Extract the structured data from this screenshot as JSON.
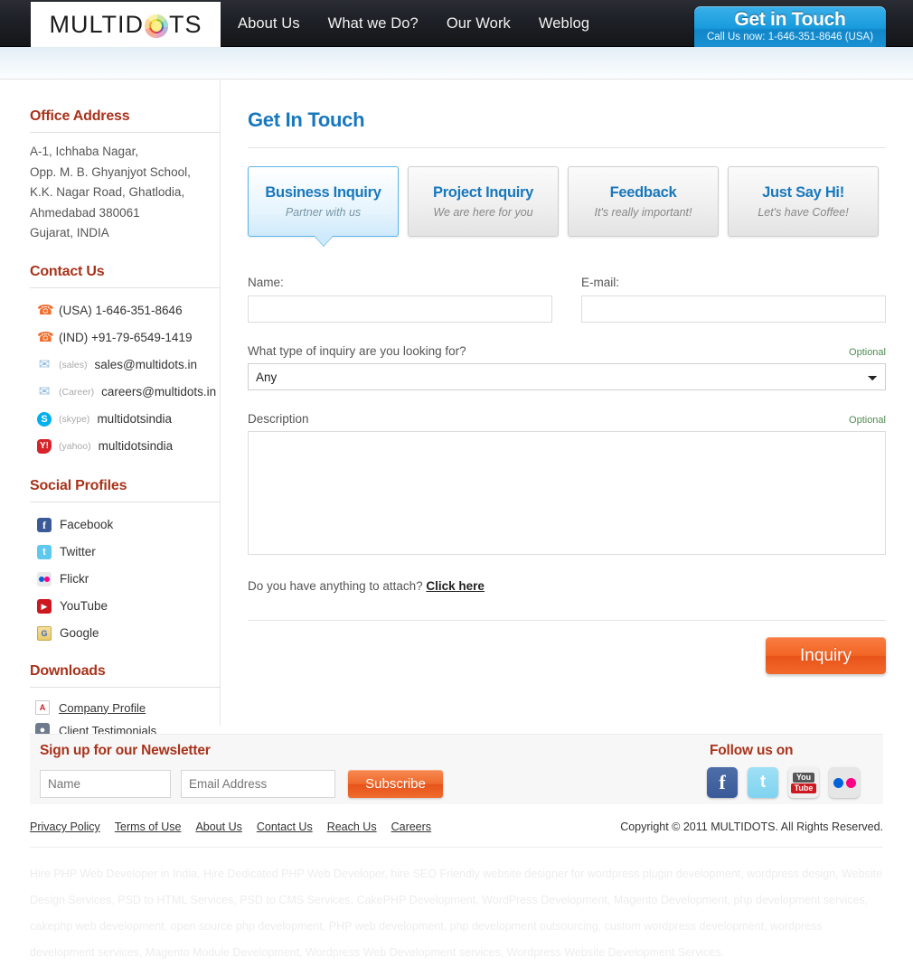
{
  "nav": {
    "logo": {
      "prefix": "MULTID",
      "dot_icon": "multidots-dot-logo",
      "suffix": "TS"
    },
    "links": [
      {
        "label": "About Us"
      },
      {
        "label": "What we Do?"
      },
      {
        "label": "Our Work"
      },
      {
        "label": "Weblog"
      }
    ],
    "cta": {
      "title": "Get in Touch",
      "subtitle": "Call Us now: 1-646-351-8646 (USA)",
      "color": "#1187c9"
    }
  },
  "sidebar": {
    "office": {
      "heading": "Office Address",
      "lines": [
        "A-1, Ichhaba Nagar,",
        "Opp. M. B. Ghyanjyot School,",
        "K.K. Nagar Road, Ghatlodia,",
        "Ahmedabad 380061",
        "Gujarat, INDIA"
      ]
    },
    "contact": {
      "heading": "Contact Us",
      "items": [
        {
          "icon": "phone-icon",
          "tag": "",
          "value": "(USA) 1-646-351-8646"
        },
        {
          "icon": "phone-icon",
          "tag": "",
          "value": "(IND) +91-79-6549-1419"
        },
        {
          "icon": "mail-icon",
          "tag": "(sales)",
          "value": "sales@multidots.in"
        },
        {
          "icon": "mail-icon",
          "tag": "(Career)",
          "value": "careers@multidots.in"
        },
        {
          "icon": "skype-icon",
          "tag": "(skype)",
          "value": "multidotsindia"
        },
        {
          "icon": "yahoo-icon",
          "tag": "(yahoo)",
          "value": "multidotsindia"
        }
      ]
    },
    "social": {
      "heading": "Social Profiles",
      "items": [
        {
          "icon": "facebook-icon",
          "label": "Facebook"
        },
        {
          "icon": "twitter-icon",
          "label": "Twitter"
        },
        {
          "icon": "flickr-icon",
          "label": "Flickr"
        },
        {
          "icon": "youtube-icon",
          "label": "YouTube"
        },
        {
          "icon": "google-icon",
          "label": "Google"
        }
      ]
    },
    "downloads": {
      "heading": "Downloads",
      "items": [
        {
          "icon": "pdf-icon",
          "label": "Company Profile"
        },
        {
          "icon": "person-icon",
          "label": "Client Testimonials"
        }
      ]
    }
  },
  "main": {
    "title": "Get In Touch",
    "tabs": [
      {
        "title": "Business Inquiry",
        "subtitle": "Partner with us",
        "active": true
      },
      {
        "title": "Project Inquiry",
        "subtitle": "We are here for you",
        "active": false
      },
      {
        "title": "Feedback",
        "subtitle": "It's really important!",
        "active": false
      },
      {
        "title": "Just Say Hi!",
        "subtitle": "Let's have Coffee!",
        "active": false
      }
    ],
    "form": {
      "name_label": "Name:",
      "name_value": "",
      "email_label": "E-mail:",
      "email_value": "",
      "inquiry_type_label": "What type of inquiry are you looking for?",
      "inquiry_type_optional": "Optional",
      "inquiry_type_value": "Any",
      "inquiry_type_options": [
        "Any"
      ],
      "description_label": "Description",
      "description_optional": "Optional",
      "description_value": "",
      "attach_text": "Do you have anything to attach?",
      "attach_link": "Click here",
      "submit_label": "Inquiry"
    }
  },
  "footer": {
    "newsletter": {
      "title": "Sign up for our Newsletter",
      "name_placeholder": "Name",
      "name_value": "",
      "email_placeholder": "Email Address",
      "email_value": "",
      "subscribe_label": "Subscribe"
    },
    "follow": {
      "title": "Follow us on",
      "icons": [
        {
          "icon": "facebook-icon",
          "glyph": "f"
        },
        {
          "icon": "twitter-icon",
          "glyph": "t"
        },
        {
          "icon": "youtube-icon",
          "top": "You",
          "bottom": "Tube"
        },
        {
          "icon": "flickr-icon",
          "glyph": ""
        }
      ]
    },
    "links": [
      {
        "label": "Privacy Policy"
      },
      {
        "label": "Terms of Use"
      },
      {
        "label": "About Us"
      },
      {
        "label": "Contact Us"
      },
      {
        "label": "Reach Us"
      },
      {
        "label": "Careers"
      }
    ],
    "copyright": "Copyright © 2011 MULTIDOTS. All Rights Reserved.",
    "seo_text": "Hire PHP Web Developer in India, Hire Dedicated PHP Web Developer, hire SEO Friendly website designer for wordpress plugin development, wordpress design, Website Design Services, PSD to HTML Services, PSD to CMS Services, CakePHP Development, WordPress Development, Magento Development, php development services, cakephp web development, open source php development, PHP web development, php development outsourcing, custom wordpress development, wordpress development services, Magento Module Development, Wordpress Web Development services, Wordpress Website Development Services."
  }
}
